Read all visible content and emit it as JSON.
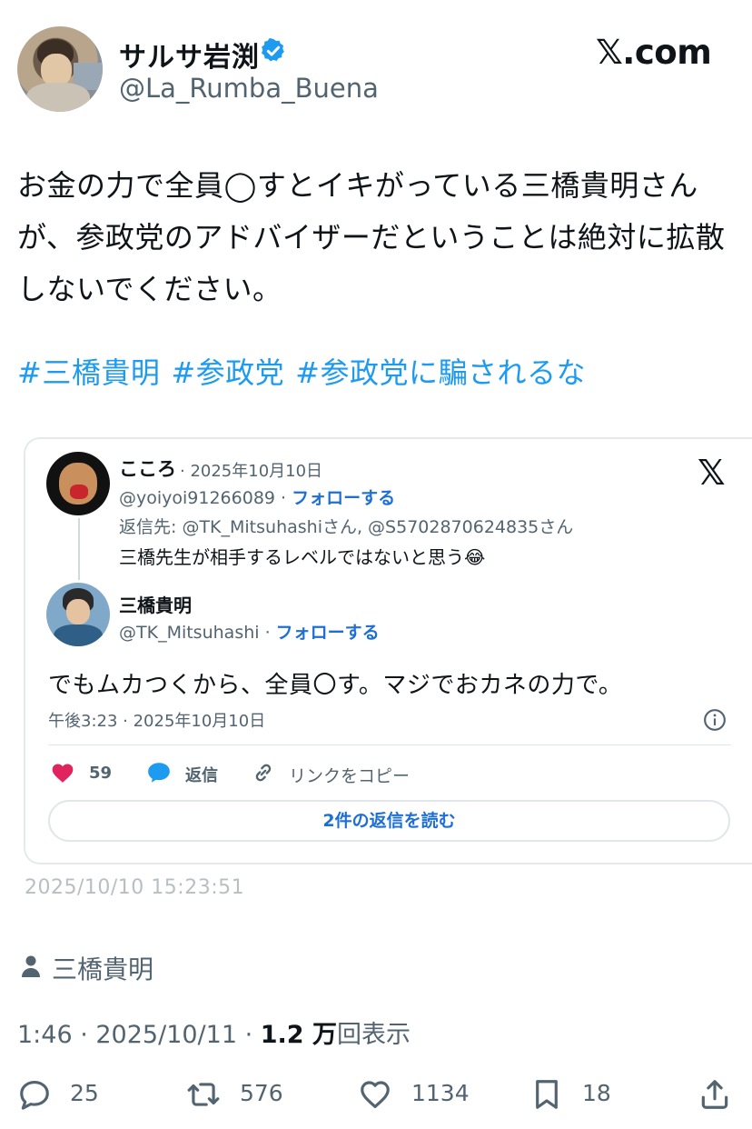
{
  "header": {
    "display_name": "サルサ岩渕",
    "handle": "@La_Rumba_Buena",
    "site": "𝕏.com"
  },
  "tweet": {
    "text": "お金の力で全員◯すとイキがっている三橋貴明さんが、参政党のアドバイザーだということは絶対に拡散しないでください。",
    "hashtags": [
      "#三橋貴明",
      "#参政党",
      "#参政党に騙されるな"
    ]
  },
  "embed": {
    "x_logo": "𝕏",
    "reply_post": {
      "name": "こころ",
      "date": "· 2025年10月10日",
      "handle": "@yoiyoi91266089 · ",
      "follow": "フォローする",
      "replying_to": "返信先: @TK_Mitsuhashiさん, @S5702870624835さん",
      "text": "三橋先生が相手するレベルではないと思う😂"
    },
    "quoted_post": {
      "name": "三橋貴明",
      "handle": "@TK_Mitsuhashi · ",
      "follow": "フォローする",
      "text": "でもムカつくから、全員〇す。マジでおカネの力で。",
      "time": "午後3:23 · 2025年10月10日"
    },
    "actions": {
      "like_count": "59",
      "reply_label": "返信",
      "copy_link_label": "リンクをコピー"
    },
    "read_replies_label": "2件の返信を読む"
  },
  "capture_timestamp": "2025/10/10 15:23:51",
  "topic": "三橋貴明",
  "meta": {
    "time_date": "1:46 · 2025/10/11 · ",
    "views_count": "1.2 万",
    "views_label": "回表示"
  },
  "actions": {
    "replies": "25",
    "reposts": "576",
    "likes": "1134",
    "bookmarks": "18"
  },
  "colors": {
    "accent": "#1d9bf0",
    "link_blue": "#1d6fd6",
    "muted": "#536471",
    "like_pink": "#e0245e"
  }
}
